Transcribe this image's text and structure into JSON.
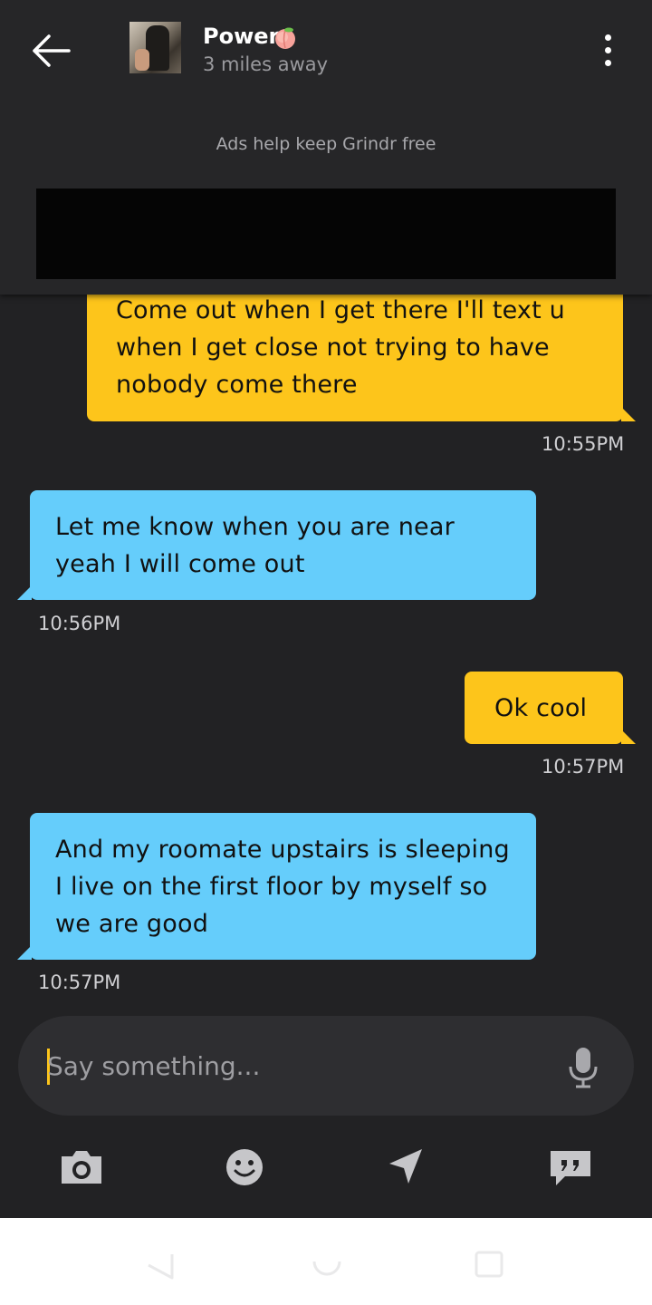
{
  "header": {
    "contact_name": "Power",
    "distance": "3 miles away",
    "ads_text": "Ads help keep Grindr free"
  },
  "messages": [
    {
      "direction": "out",
      "text": "Come out when I get there I'll text u when I get close not trying to have nobody come there",
      "time": "10:55PM"
    },
    {
      "direction": "in",
      "text": "Let me know when you are near yeah I will come out",
      "time": "10:56PM"
    },
    {
      "direction": "out",
      "text": "Ok cool",
      "time": "10:57PM"
    },
    {
      "direction": "in",
      "text": "And my roomate upstairs is sleeping I live on the first floor by myself so we are good",
      "time": "10:57PM"
    }
  ],
  "composer": {
    "placeholder": "Say something..."
  },
  "toolbar": {
    "icons": [
      "camera-icon",
      "emoji-icon",
      "location-icon",
      "saved-phrases-icon"
    ]
  },
  "colors": {
    "outgoing_bubble": "#fdc51b",
    "incoming_bubble": "#65cdfb",
    "background": "#222224",
    "accent": "#fdc51b"
  }
}
